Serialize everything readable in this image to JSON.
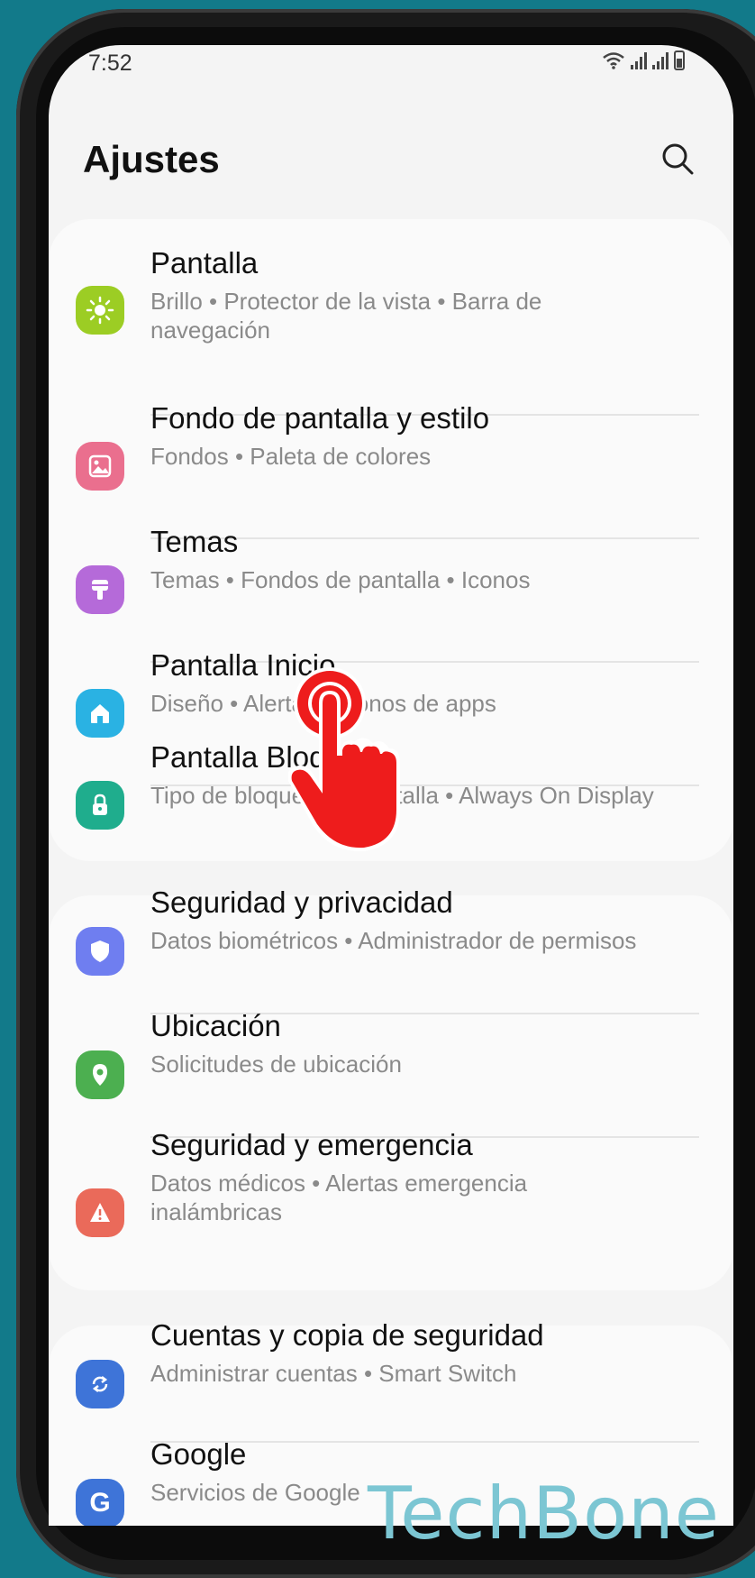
{
  "status": {
    "time": "7:52"
  },
  "header": {
    "title": "Ajustes"
  },
  "groups": [
    {
      "items": [
        {
          "title": "Pantalla",
          "subtitle": "Brillo • Protector de la vista • Barra de navegación",
          "icon": "sun-icon",
          "color": "#9ccd24"
        },
        {
          "title": "Fondo de pantalla y estilo",
          "subtitle": "Fondos • Paleta de colores",
          "icon": "image-icon",
          "color": "#ea6f8e"
        },
        {
          "title": "Temas",
          "subtitle": "Temas • Fondos de pantalla • Iconos",
          "icon": "brush-icon",
          "color": "#b56ad9"
        },
        {
          "title": "Pantalla Inicio",
          "subtitle": "Diseño • Alertas • Iconos de apps",
          "icon": "home-icon",
          "color": "#2ab2e3"
        },
        {
          "title": "Pantalla Bloqueo",
          "subtitle": "Tipo de bloqueo de pantalla • Always On Display",
          "icon": "lock-icon",
          "color": "#1fad8d"
        }
      ]
    },
    {
      "items": [
        {
          "title": "Seguridad y privacidad",
          "subtitle": "Datos biométricos • Administrador de permisos",
          "icon": "shield-icon",
          "color": "#6f7ef0"
        },
        {
          "title": "Ubicación",
          "subtitle": "Solicitudes de ubicación",
          "icon": "location-pin-icon",
          "color": "#4caf50"
        },
        {
          "title": "Seguridad y emergencia",
          "subtitle": "Datos médicos • Alertas emergencia inalámbricas",
          "icon": "alert-icon",
          "color": "#ea6a5a"
        }
      ]
    },
    {
      "items": [
        {
          "title": "Cuentas y copia de seguridad",
          "subtitle": "Administrar cuentas • Smart Switch",
          "icon": "sync-icon",
          "color": "#3e74d8"
        },
        {
          "title": "Google",
          "subtitle": "Servicios de Google",
          "icon": "google-icon",
          "color": "#3e74d8"
        }
      ]
    }
  ],
  "watermark": "TechBone",
  "accent": {
    "tap_hand": "#ee1c1c"
  }
}
